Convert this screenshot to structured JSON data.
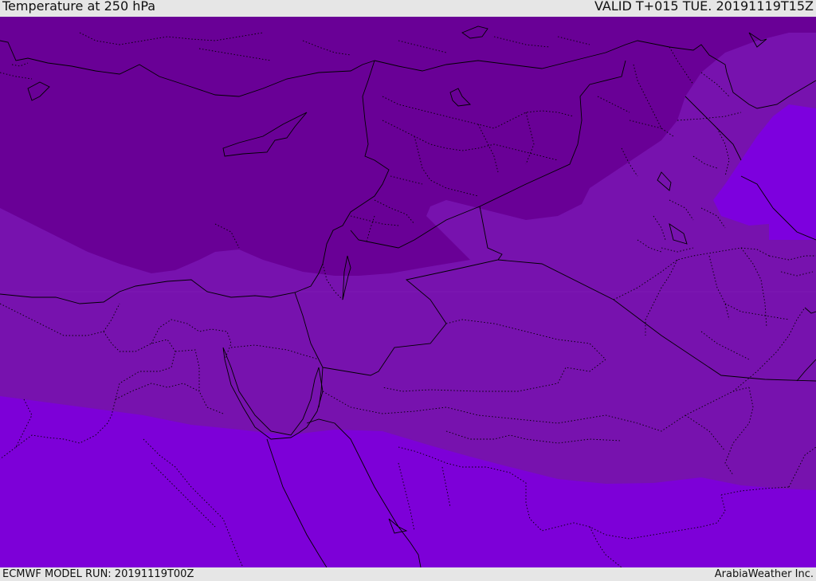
{
  "header": {
    "title": "Temperature at 250 hPa",
    "valid": "VALID T+015 TUE. 20191119T15Z"
  },
  "footer": {
    "model_run": "ECMWF MODEL RUN: 20191119T00Z",
    "credit": "ArabiaWeather Inc."
  },
  "map": {
    "colors": {
      "band_darkest": "#690096",
      "band_middle": "#7712AE",
      "band_light": "#7D00D8",
      "band_east": "#7D00DE",
      "border_line": "#000000"
    }
  }
}
